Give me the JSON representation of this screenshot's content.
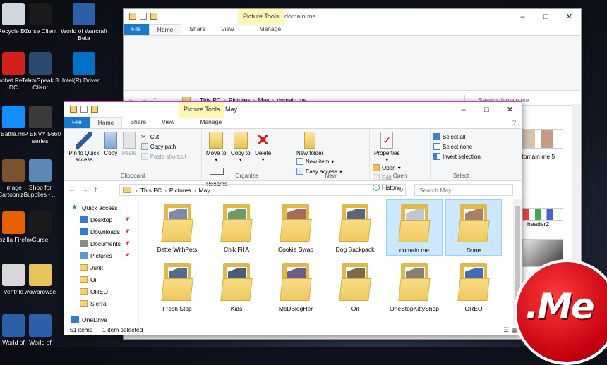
{
  "desktop": {
    "icons": [
      {
        "label": "Recycle Bin",
        "icon": "recycle-bin-icon",
        "color": "#cfd8e0"
      },
      {
        "label": "Curse Client",
        "icon": "curse-icon",
        "color": "#1a1a1a"
      },
      {
        "label": "World of Warcraft Beta",
        "icon": "wow-icon",
        "color": "#2b5fa8"
      },
      {
        "label": "Acrobat Reader DC",
        "icon": "acrobat-icon",
        "color": "#d4201c"
      },
      {
        "label": "TeamSpeak 3 Client",
        "icon": "teamspeak-icon",
        "color": "#2b4a70"
      },
      {
        "label": "Intel(R) Driver ...",
        "icon": "intel-icon",
        "color": "#0071c5"
      },
      {
        "label": "Battle.net",
        "icon": "battlenet-icon",
        "color": "#148eff"
      },
      {
        "label": "HP ENVY 5660 series",
        "icon": "printer-icon",
        "color": "#3a3a3a"
      },
      {
        "label": "Image Cartoonizer",
        "icon": "cartoonizer-icon",
        "color": "#7a5230"
      },
      {
        "label": "Shop for Supplies - ...",
        "icon": "shop-icon",
        "color": "#5b88b5"
      },
      {
        "label": "Mozilla Firefox",
        "icon": "firefox-icon",
        "color": "#e66000"
      },
      {
        "label": "Curse",
        "icon": "curse-icon",
        "color": "#1a1a1a"
      },
      {
        "label": "Ventrilo",
        "icon": "ventrilo-icon",
        "color": "#d8d8d8"
      },
      {
        "label": "wowbrowse",
        "icon": "folder-icon",
        "color": "#e8c35a"
      },
      {
        "label": "World of",
        "icon": "wow-icon",
        "color": "#2b5fa8"
      },
      {
        "label": "World of",
        "icon": "wow-icon",
        "color": "#2b5fa8"
      }
    ]
  },
  "back_window": {
    "context_tab": "Picture Tools",
    "title": "domain me",
    "tabs": [
      "File",
      "Home",
      "Share",
      "View",
      "Manage"
    ],
    "breadcrumb": [
      "This PC",
      "Pictures",
      "May",
      "domain me"
    ],
    "search_placeholder": "Search domain me",
    "visible_items": [
      "domain me 5",
      "header2"
    ]
  },
  "front_window": {
    "context_tab": "Picture Tools",
    "title": "May",
    "tabs": [
      "File",
      "Home",
      "Share",
      "View",
      "Manage"
    ],
    "ribbon": {
      "clipboard": {
        "label": "Clipboard",
        "pin": "Pin to Quick access",
        "copy": "Copy",
        "paste": "Paste",
        "cut": "Cut",
        "copy_path": "Copy path",
        "paste_shortcut": "Paste shortcut"
      },
      "organize": {
        "label": "Organize",
        "move_to": "Move to",
        "copy_to": "Copy to",
        "delete": "Delete",
        "rename": "Rename"
      },
      "new": {
        "label": "New",
        "new_folder": "New folder",
        "new_item": "New item",
        "easy_access": "Easy access"
      },
      "open": {
        "label": "Open",
        "properties": "Properties",
        "open": "Open",
        "edit": "Edit",
        "history": "History"
      },
      "select": {
        "label": "Select",
        "select_all": "Select all",
        "select_none": "Select none",
        "invert": "Invert selection"
      }
    },
    "breadcrumb": [
      "This PC",
      "Pictures",
      "May"
    ],
    "search_placeholder": "Search May",
    "nav": [
      {
        "label": "Quick access",
        "root": true,
        "pinned": false
      },
      {
        "label": "Desktop",
        "pinned": true
      },
      {
        "label": "Downloads",
        "pinned": true
      },
      {
        "label": "Documents",
        "pinned": true
      },
      {
        "label": "Pictures",
        "pinned": true
      },
      {
        "label": "Junk",
        "pinned": false
      },
      {
        "label": "Oil",
        "pinned": false
      },
      {
        "label": "OREO",
        "pinned": false
      },
      {
        "label": "Sierra",
        "pinned": false
      },
      {
        "label": "OneDrive",
        "root": true,
        "pinned": false
      }
    ],
    "folders": [
      {
        "name": "BetterWithPets",
        "selected": false,
        "color": "#7a8aa8"
      },
      {
        "name": "Chik Fil A",
        "selected": false,
        "color": "#6d9a6a"
      },
      {
        "name": "Cookie Swap",
        "selected": false,
        "color": "#a86a5a"
      },
      {
        "name": "Dog Backpack",
        "selected": false,
        "color": "#5b6578"
      },
      {
        "name": "domain me",
        "selected": true,
        "color": "#c0c8cf"
      },
      {
        "name": "Done",
        "selected": true,
        "color": "#a97f6a"
      },
      {
        "name": "Fresh Step",
        "selected": false,
        "color": "#556b8a"
      },
      {
        "name": "Kids",
        "selected": false,
        "color": "#4d5b7a"
      },
      {
        "name": "McDBlogHer",
        "selected": false,
        "color": "#6f5a8c"
      },
      {
        "name": "Oil",
        "selected": false,
        "color": "#7d6a4b"
      },
      {
        "name": "OneStopKittyShop",
        "selected": false,
        "color": "#8a7f70"
      },
      {
        "name": "OREO",
        "selected": false,
        "color": "#3f6fb0"
      }
    ],
    "status": {
      "count": "51 items",
      "selected": "1 item selected"
    }
  },
  "logo": {
    "text": ".Me",
    "color": "#c40010"
  }
}
